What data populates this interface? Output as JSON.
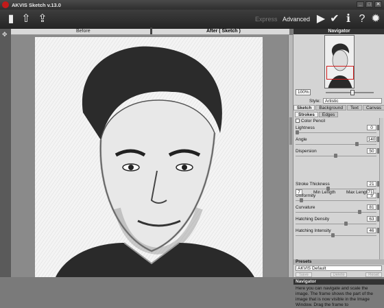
{
  "window": {
    "title": "AKVIS Sketch v.13.0",
    "buttons": [
      "_",
      "□",
      "✕"
    ]
  },
  "toolbar": {
    "mode_express": "Express",
    "mode_advanced": "Advanced",
    "icons": [
      "open-image-icon",
      "save-image-icon",
      "share-image-icon",
      "run-icon",
      "apply-icon",
      "info-icon",
      "help-icon",
      "settings-icon"
    ]
  },
  "view": {
    "tab_before": "Before",
    "tab_after": "After ( Sketch )"
  },
  "navigator": {
    "title": "Navigator",
    "zoom": "100%"
  },
  "settings": {
    "style_label": "Style:",
    "style_value": "Artistic",
    "tabs": [
      "Sketch",
      "Background",
      "Text",
      "Canvas"
    ],
    "subtabs": [
      "Strokes",
      "Edges"
    ],
    "color_pencil": "Color Pencil",
    "params": [
      {
        "label": "Lightness",
        "value": "0",
        "position": 0.0
      },
      {
        "label": "Angle",
        "value": "140",
        "position": 0.78
      },
      {
        "label": "Dispersion",
        "value": "50",
        "position": 0.5
      },
      {
        "label": "Stroke Thickness",
        "value": "21",
        "position": 0.4
      },
      {
        "label": "Uniformity",
        "value": "5",
        "position": 0.05
      },
      {
        "label": "Curvature",
        "value": "81",
        "position": 0.81
      },
      {
        "label": "Hatching Density",
        "value": "63",
        "position": 0.63
      },
      {
        "label": "Hatching Intensity",
        "value": "46",
        "position": 0.46
      }
    ],
    "min_length_label": "Min Length",
    "min_length_value": "7",
    "max_length_label": "Max Length",
    "max_length_value": "71"
  },
  "presets": {
    "title": "Presets",
    "selected": "AKVIS Default",
    "buttons": [
      "Save",
      "Delete",
      "Reset"
    ]
  },
  "help": {
    "title": "Navigator",
    "text": "Here you can navigate and scale the image. The frame shows the part of the image that is now visible in the Image Window. Drag the frame to"
  },
  "colors": {
    "toolbar_bg": "#2e2e2e",
    "panel_bg": "#d4d4d4",
    "accent": "#d21c1c"
  }
}
